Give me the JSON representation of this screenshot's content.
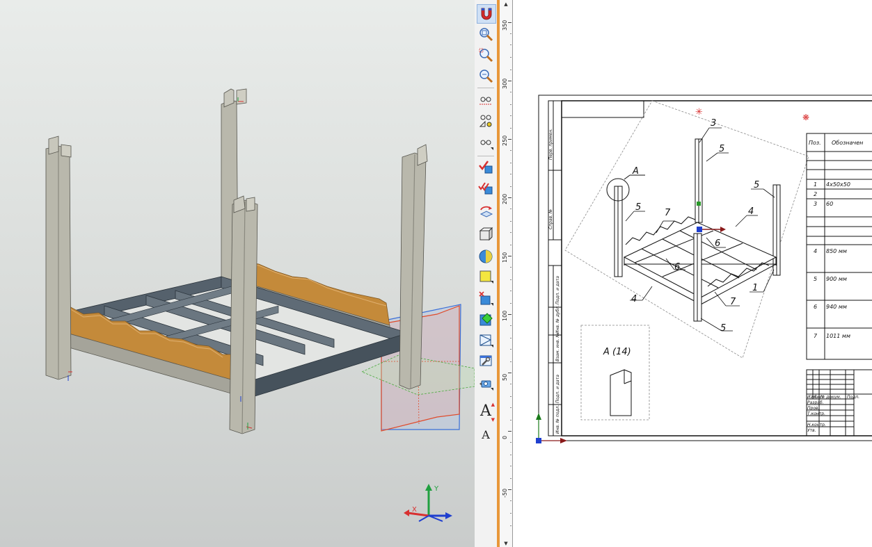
{
  "window": {
    "title": ""
  },
  "toolbar": {
    "buttons": [
      {
        "name": "magnet-snap-button",
        "icon": "magnet-icon"
      },
      {
        "name": "zoom-window-button",
        "icon": "zoom-window-icon"
      },
      {
        "name": "zoom-dynamic-button",
        "icon": "zoom-dynamic-icon"
      },
      {
        "name": "zoom-fit-button",
        "icon": "zoom-fit-icon"
      },
      {
        "name": "hidden-lines-button",
        "icon": "glasses-icon"
      },
      {
        "name": "measure-angle-button",
        "icon": "glasses-angle-icon"
      },
      {
        "name": "view-options-button",
        "icon": "glasses-icon"
      },
      {
        "name": "check-geometry-button",
        "icon": "check-cube-icon"
      },
      {
        "name": "check-all-button",
        "icon": "double-check-cube-icon"
      },
      {
        "name": "rotate-plane-button",
        "icon": "rotate-plane-icon"
      },
      {
        "name": "view-cube-button",
        "icon": "cube-wireframe-icon"
      },
      {
        "name": "sphere-button",
        "icon": "sphere-icon"
      },
      {
        "name": "yellow-face-button",
        "icon": "face-icon"
      },
      {
        "name": "section-button",
        "icon": "section-cube-icon"
      },
      {
        "name": "diamond-button",
        "icon": "green-diamond-icon"
      },
      {
        "name": "projection-button",
        "icon": "projection-icon"
      },
      {
        "name": "wrench-button",
        "icon": "wrench-icon"
      },
      {
        "name": "camera-button",
        "icon": "camera-icon"
      },
      {
        "name": "text-large-button",
        "icon": "text-icon",
        "label": "A"
      },
      {
        "name": "text-small-button",
        "icon": "text-icon",
        "label": "A"
      }
    ]
  },
  "ruler": {
    "labels": [
      "350",
      "300",
      "250",
      "200",
      "150",
      "100",
      "50",
      "0",
      "-50"
    ]
  },
  "axis_triad": {
    "x_label": "X",
    "y_label": "Y",
    "colors": {
      "x": "#d83030",
      "y": "#20a040",
      "z": "#1f3fcf"
    }
  },
  "drawing": {
    "balloons": [
      "3",
      "5",
      "5",
      "5",
      "4",
      "7",
      "6",
      "6",
      "4",
      "1",
      "7",
      "5",
      "5"
    ],
    "callout_a": "A",
    "detail_view_label": "A (14)",
    "spec_table": {
      "headers": [
        "Поз.",
        "Обозначен"
      ],
      "rows": [
        {
          "pos": "1",
          "desc": "4х50х50"
        },
        {
          "pos": "2",
          "desc": ""
        },
        {
          "pos": "3",
          "desc": "60"
        },
        {
          "pos": "4",
          "desc": "850 мм"
        },
        {
          "pos": "5",
          "desc": "900 мм"
        },
        {
          "pos": "6",
          "desc": "940 мм"
        },
        {
          "pos": "7",
          "desc": "1011 мм"
        }
      ]
    },
    "title_block_rows": [
      "Изм.",
      "Лист",
      "№ докум.",
      "Подп."
    ],
    "title_block_labels": [
      "Разраб.",
      "Пров.",
      "Т.контр.",
      "Н.контр.",
      "Утв."
    ],
    "side_stamps": [
      "Перв. примен.",
      "Справ. №",
      "Подп. и дата",
      "Инв. № дубл.",
      "Взам. инв. №",
      "Подп. и дата",
      "Инв. № подл."
    ]
  },
  "colors": {
    "accent": "#e8973a",
    "frame": "#3d4a57",
    "wood": "#c48a3a",
    "post": "#b9b8ac"
  }
}
